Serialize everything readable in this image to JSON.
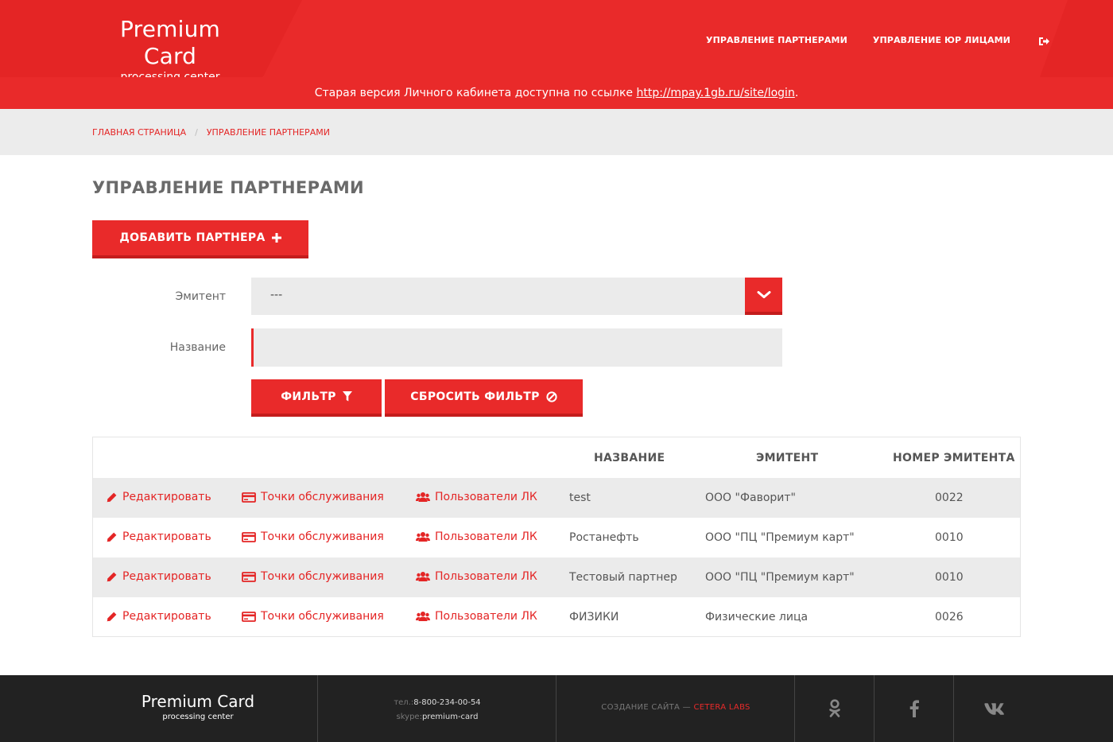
{
  "brand": {
    "name": "Premium Card",
    "tagline": "processing center"
  },
  "nav": {
    "partners": "УПРАВЛЕНИЕ ПАРТНЕРАМИ",
    "legal": "УПРАВЛЕНИЕ ЮР ЛИЦАМИ",
    "logout_icon": "sign-out-icon"
  },
  "notice": {
    "text": "Старая версия Личного кабинета доступна по ссылке ",
    "link": "http://mpay.1gb.ru/site/login",
    "tail": "."
  },
  "breadcrumbs": [
    "ГЛАВНАЯ СТРАНИЦА",
    "УПРАВЛЕНИЕ ПАРТНЕРАМИ"
  ],
  "page_title": "УПРАВЛЕНИЕ ПАРТНЕРАМИ",
  "add_button": "ДОБАВИТЬ ПАРТНЕРА",
  "filter": {
    "emitent_label": "Эмитент",
    "emitent_value": "---",
    "name_label": "Название",
    "name_value": "",
    "filter_button": "ФИЛЬТР",
    "reset_button": "СБРОСИТЬ ФИЛЬТР"
  },
  "table": {
    "columns": [
      "НАЗВАНИЕ",
      "ЭМИТЕНТ",
      "НОМЕР ЭМИТЕНТА"
    ],
    "actions": {
      "edit": "Редактировать",
      "points": "Точки обслуживания",
      "users": "Пользователи ЛК"
    },
    "rows": [
      {
        "name": "test",
        "emitent": "ООО \"Фаворит\"",
        "number": "0022"
      },
      {
        "name": "Ростанефть",
        "emitent": "ООО \"ПЦ \"Премиум карт\"",
        "number": "0010"
      },
      {
        "name": "Тестовый партнер",
        "emitent": "ООО \"ПЦ \"Премиум карт\"",
        "number": "0010"
      },
      {
        "name": "ФИЗИКИ",
        "emitent": "Физические лица",
        "number": "0026"
      }
    ]
  },
  "footer": {
    "brand": "Premium Card",
    "tagline": "processing center",
    "phone_label": "тел.:",
    "phone": "8-800-234-00-54",
    "skype_label": "skype:",
    "skype": "premium-card",
    "credit_text": "СОЗДАНИЕ САЙТА — ",
    "credit_link": "CETERA LABS",
    "social": [
      "odnoklassniki-icon",
      "facebook-icon",
      "vk-icon"
    ]
  },
  "colors": {
    "brand_red": "#e92a2a",
    "dark_red": "#c41c1c",
    "footer_bg": "#222222",
    "field_bg": "#ebebeb"
  }
}
